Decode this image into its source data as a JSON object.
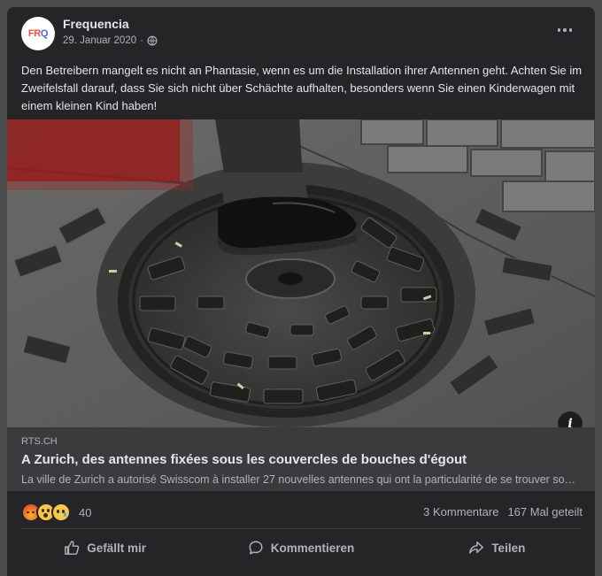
{
  "post": {
    "page_name": "Frequencia",
    "avatar_letters": [
      "FR",
      "Q"
    ],
    "date": "29. Januar 2020",
    "separator": "·",
    "privacy_icon": "globe-icon",
    "body_text": "Den Betreibern mangelt es nicht an Phantasie, wenn es um die Installation ihrer Antennen geht. Achten Sie im Zweifelsfall darauf, dass Sie sich nicht über Schächte aufhalten, besonders wenn Sie einen Kinderwagen mit einem kleinen Kind haben!"
  },
  "image": {
    "subject": "manhole cover with foot stepping on it",
    "info_icon": "i"
  },
  "link": {
    "domain": "RTS.CH",
    "title": "A Zurich, des antennes fixées sous les couvercles de bouches d'égout",
    "description": "La ville de Zurich a autorisé Swisscom à installer 27 nouvelles antennes qui ont la particularité de se trouver sous les couvercles de bouches d'égout."
  },
  "engagement": {
    "reaction_icons": [
      "angry-icon",
      "wow-icon",
      "sad-icon"
    ],
    "reaction_count": "40",
    "comments": "3 Kommentare",
    "shares": "167 Mal geteilt"
  },
  "actions": {
    "like": "Gefällt mir",
    "comment": "Kommentieren",
    "share": "Teilen"
  },
  "colors": {
    "card_bg": "#242526",
    "link_bg": "#3a3b3c",
    "text_primary": "#e4e6eb",
    "text_secondary": "#b0b3b8"
  }
}
